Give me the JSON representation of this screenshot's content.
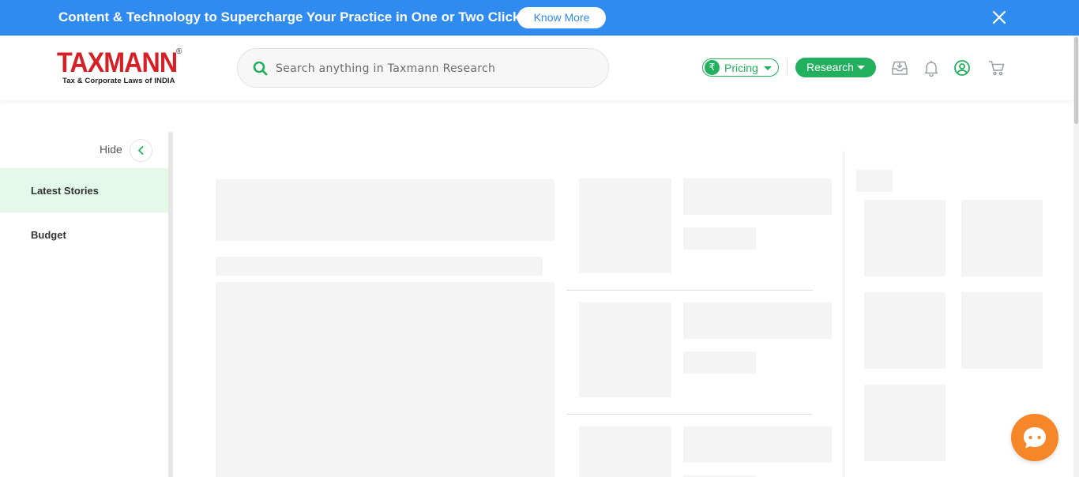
{
  "promo": {
    "text": "Content & Technology to Supercharge Your Practice in One or Two Clicks.",
    "button_label": "Know More",
    "close_icon": "close-icon"
  },
  "header": {
    "logo_text": "TAXMANN",
    "logo_reg": "®",
    "logo_tagline": "Tax & Corporate Laws of INDIA",
    "search": {
      "placeholder": "Search anything in Taxmann Research",
      "value": ""
    },
    "pricing": {
      "symbol": "₹",
      "label": "Pricing"
    },
    "research": {
      "label": "Research"
    },
    "icons": [
      "inbox-download-icon",
      "bell-icon",
      "user-account-icon",
      "cart-icon"
    ]
  },
  "sidebar": {
    "hide_label": "Hide",
    "items": [
      {
        "label": "Latest Stories",
        "active": true
      },
      {
        "label": "Budget",
        "active": false
      }
    ]
  },
  "colors": {
    "promo_blue": "#2f8bef",
    "brand_green": "#23b05e",
    "brand_red": "#d71f26",
    "active_bg": "#e3f9ea",
    "chat_orange": "#f6862a",
    "skeleton": "#f4f4f5"
  }
}
